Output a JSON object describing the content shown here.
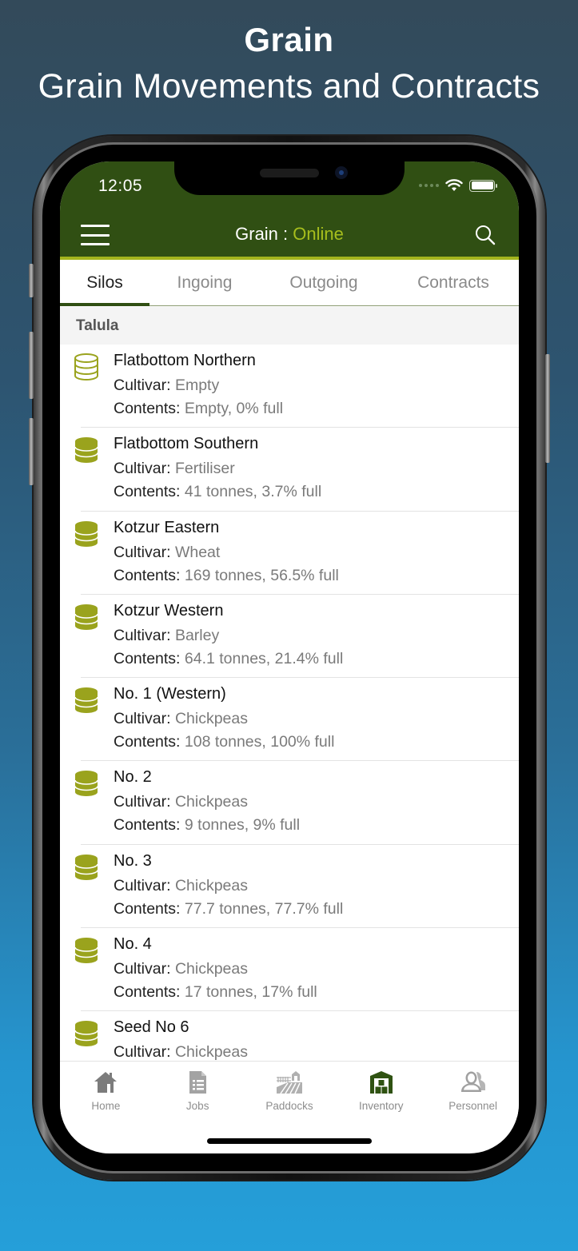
{
  "promo": {
    "title": "Grain",
    "subtitle": "Grain Movements and Contracts"
  },
  "status_bar": {
    "time": "12:05",
    "icons": [
      "signal-dots-icon",
      "wifi-icon",
      "battery-icon"
    ]
  },
  "nav_bar": {
    "title_prefix": "Grain : ",
    "status": "Online",
    "menu_icon": "hamburger-menu-icon",
    "search_icon": "search-icon"
  },
  "colors": {
    "header_bg": "#304f13",
    "accent": "#a6be1d",
    "silo_icon": "#9aa31d",
    "active_tab_indicator": "#304f13",
    "inventory_active": "#2f5212"
  },
  "tabs": [
    {
      "label": "Silos",
      "active": true
    },
    {
      "label": "Ingoing",
      "active": false
    },
    {
      "label": "Outgoing",
      "active": false
    },
    {
      "label": "Contracts",
      "active": false
    }
  ],
  "section": {
    "title": "Talula"
  },
  "labels": {
    "cultivar": "Cultivar: ",
    "contents": "Contents: "
  },
  "silos": [
    {
      "name": "Flatbottom Northern",
      "cultivar": "Empty",
      "contents": "Empty, 0% full",
      "icon": "silo-empty-icon"
    },
    {
      "name": "Flatbottom Southern",
      "cultivar": "Fertiliser",
      "contents": "41 tonnes, 3.7% full",
      "icon": "silo-filled-icon"
    },
    {
      "name": "Kotzur Eastern",
      "cultivar": "Wheat",
      "contents": "169 tonnes, 56.5% full",
      "icon": "silo-filled-icon"
    },
    {
      "name": "Kotzur Western",
      "cultivar": "Barley",
      "contents": "64.1 tonnes, 21.4% full",
      "icon": "silo-filled-icon"
    },
    {
      "name": "No. 1 (Western)",
      "cultivar": "Chickpeas",
      "contents": "108 tonnes, 100% full",
      "icon": "silo-filled-icon"
    },
    {
      "name": "No. 2",
      "cultivar": "Chickpeas",
      "contents": "9 tonnes, 9% full",
      "icon": "silo-filled-icon"
    },
    {
      "name": "No. 3",
      "cultivar": "Chickpeas",
      "contents": "77.7 tonnes, 77.7% full",
      "icon": "silo-filled-icon"
    },
    {
      "name": "No. 4",
      "cultivar": "Chickpeas",
      "contents": "17 tonnes, 17% full",
      "icon": "silo-filled-icon"
    },
    {
      "name": "Seed No 6",
      "cultivar": "Chickpeas",
      "contents": "",
      "icon": "silo-filled-icon"
    }
  ],
  "bottom_nav": [
    {
      "label": "Home",
      "icon": "home-icon",
      "active": false
    },
    {
      "label": "Jobs",
      "icon": "document-list-icon",
      "active": false
    },
    {
      "label": "Paddocks",
      "icon": "paddock-field-icon",
      "active": false
    },
    {
      "label": "Inventory",
      "icon": "shed-inventory-icon",
      "active": true
    },
    {
      "label": "Personnel",
      "icon": "people-icon",
      "active": false
    }
  ]
}
